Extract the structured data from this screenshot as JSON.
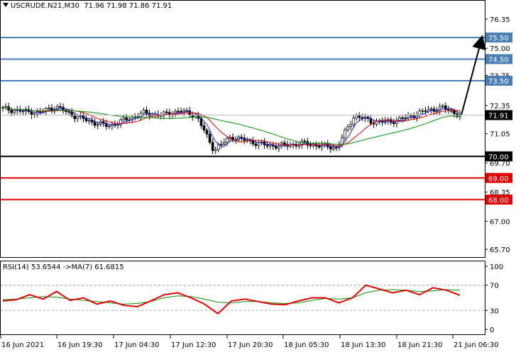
{
  "header": {
    "symbol": "USCRUDE.N21,M30",
    "ohlc": "71.96 71.98 71.86 71.91"
  },
  "price_axis": {
    "ticks": [
      "76.35",
      "75.00",
      "73.75",
      "72.35",
      "71.05",
      "69.70",
      "68.35",
      "67.00",
      "65.70"
    ],
    "current_price": "71.91"
  },
  "levels": [
    {
      "label": "75.50",
      "value": 75.5,
      "color": "#4a7fb5",
      "kind": "target"
    },
    {
      "label": "74.50",
      "value": 74.5,
      "color": "#4a7fb5",
      "kind": "target"
    },
    {
      "label": "73.50",
      "value": 73.5,
      "color": "#4a7fb5",
      "kind": "target"
    },
    {
      "label": "70.00",
      "value": 70.0,
      "color": "#000000",
      "kind": "pivot"
    },
    {
      "label": "69.00",
      "value": 69.0,
      "color": "#e00000",
      "kind": "support"
    },
    {
      "label": "68.00",
      "value": 68.0,
      "color": "#e00000",
      "kind": "support"
    }
  ],
  "rsi": {
    "label": "RSI(14) 53.6544  ->MA(7) 61.6815",
    "ticks": [
      "100",
      "70",
      "30",
      "0"
    ]
  },
  "time_axis": {
    "labels": [
      "16 Jun 2021",
      "16 Jun 19:30",
      "17 Jun 04:30",
      "17 Jun 12:30",
      "17 Jun 20:30",
      "18 Jun 05:30",
      "18 Jun 13:30",
      "18 Jun 21:30",
      "21 Jun 06:30"
    ]
  },
  "colors": {
    "ma_fast": "#2020d0",
    "ma_mid": "#e00000",
    "ma_slow": "#0a8a0a",
    "rsi_line": "#e00000",
    "rsi_ma": "#0a8a0a",
    "arrow": "#000000"
  },
  "chart_data": {
    "type": "candlestick",
    "symbol": "USCRUDE.N21",
    "timeframe": "M30",
    "ylim": [
      65.7,
      76.35
    ],
    "x": [
      "16 Jun 2021",
      "16 Jun 19:30",
      "17 Jun 04:30",
      "17 Jun 12:30",
      "17 Jun 20:30",
      "18 Jun 05:30",
      "18 Jun 13:30",
      "18 Jun 21:30",
      "21 Jun 06:30"
    ],
    "close_path": [
      72.2,
      72.1,
      72.0,
      72.3,
      71.9,
      71.6,
      71.4,
      71.7,
      72.0,
      71.9,
      72.1,
      71.9,
      70.3,
      70.9,
      70.7,
      70.5,
      70.5,
      70.6,
      70.5,
      70.4,
      71.9,
      71.6,
      71.6,
      71.8,
      72.1,
      72.25,
      71.91
    ],
    "forecast_arrow": {
      "from": 71.91,
      "to": 75.5
    },
    "rsi": {
      "ylim": [
        0,
        100
      ],
      "levels": [
        70,
        30
      ],
      "values": [
        45,
        47,
        55,
        48,
        60,
        46,
        50,
        40,
        45,
        38,
        36,
        45,
        55,
        58,
        50,
        40,
        25,
        45,
        48,
        44,
        40,
        39,
        45,
        50,
        50,
        42,
        50,
        70,
        64,
        58,
        62,
        55,
        66,
        62,
        54
      ],
      "ma_values": [
        47,
        48,
        50,
        52,
        51,
        48,
        46,
        44,
        42,
        40,
        41,
        44,
        50,
        53,
        52,
        48,
        43,
        42,
        44,
        44,
        42,
        41,
        42,
        46,
        49,
        48,
        50,
        58,
        62,
        63,
        62,
        60,
        61,
        63,
        62
      ]
    }
  }
}
